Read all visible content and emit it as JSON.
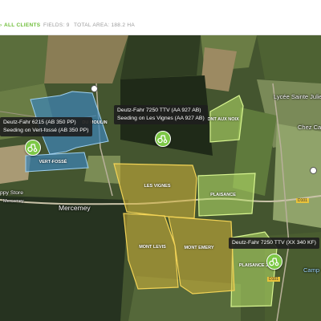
{
  "header": {
    "breadcrumb_fragment": "›",
    "clients_label": "ALL CLIENTS",
    "fields_label": "FIELDS: 9",
    "area_label": "TOTAL AREA: 188.2 HA"
  },
  "colors": {
    "accent": "#6fbe3a",
    "field_blue": "#3d84b5",
    "field_yellow": "#d4b43a",
    "field_lightgreen": "#b8e26a"
  },
  "fields": [
    {
      "label": "DU MOULIN",
      "group": "blue"
    },
    {
      "label": "VERT-FOSSÉ",
      "group": "blue"
    },
    {
      "label": "ONT AUX NOIX",
      "group": "light-green"
    },
    {
      "label": "LES VIGNES",
      "group": "yellow"
    },
    {
      "label": "PLAISANCE",
      "group": "light-green"
    },
    {
      "label": "MONT LEVIS",
      "group": "yellow"
    },
    {
      "label": "MONT EMERY",
      "group": "yellow"
    },
    {
      "label": "PLAISANCE 2",
      "group": "light-green"
    }
  ],
  "machines": [
    {
      "line1": "Deutz-Fahr 6215 (AB 350 PP)",
      "line2": "Seeding on Vert-fossé (AB 350 PP)",
      "icon": "tractor-icon"
    },
    {
      "line1": "Deutz-Fahr 7250 TTV (AA 927 AB)",
      "line2": "Seeding on Les Vignes (AA 927 AB)",
      "icon": "tractor-icon"
    },
    {
      "line1": "Deutz-Fahr 7250 TTV (XX 340 KF)",
      "line2": "",
      "icon": "tractor-icon"
    }
  ],
  "places": [
    {
      "label": "Lycée Sainte Julie"
    },
    {
      "label": "Chez Ca"
    },
    {
      "label": "Mercemey"
    },
    {
      "label": "ppy Store"
    },
    {
      "label": "Mercemey"
    },
    {
      "label": "Camp"
    }
  ],
  "roads": [
    {
      "label": "D101"
    },
    {
      "label": "D101"
    }
  ]
}
